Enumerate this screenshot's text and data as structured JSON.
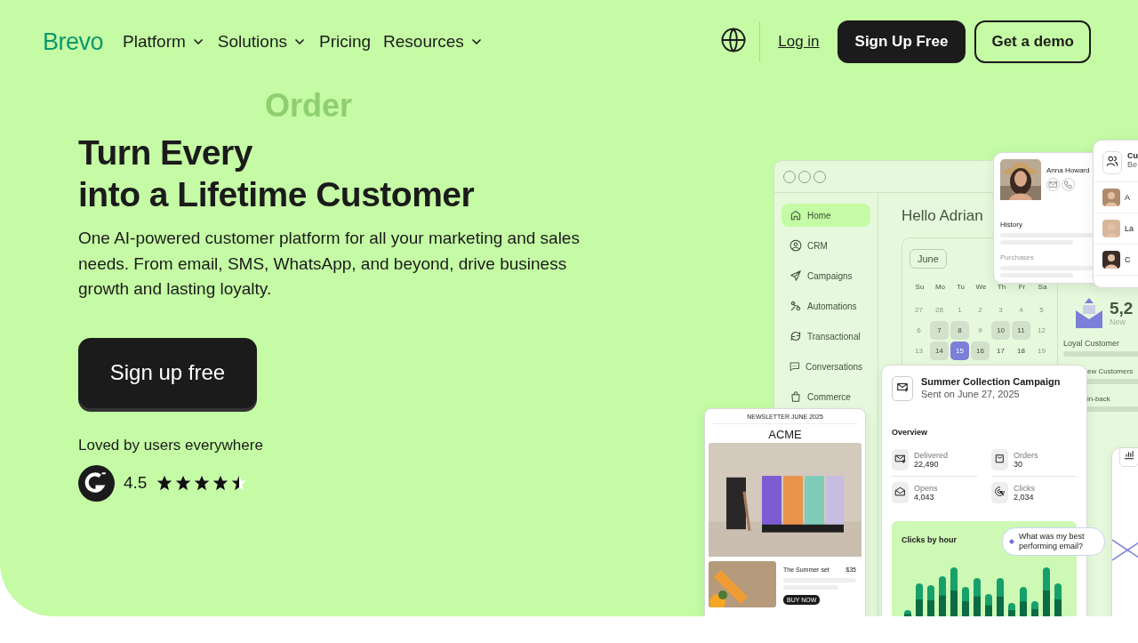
{
  "header": {
    "logo": "Brevo",
    "nav": [
      {
        "label": "Platform",
        "dropdown": true
      },
      {
        "label": "Solutions",
        "dropdown": true
      },
      {
        "label": "Pricing",
        "dropdown": false
      },
      {
        "label": "Resources",
        "dropdown": true
      }
    ],
    "login": "Log in",
    "signup": "Sign Up Free",
    "demo": "Get a demo"
  },
  "hero": {
    "ghost_word": "Order",
    "title_lines": [
      "Turn Every",
      "into a Lifetime Customer"
    ],
    "description": "One AI-powered customer platform for all your marketing and sales needs. From email, SMS, WhatsApp, and beyond, drive business growth and lasting loyalty.",
    "cta": "Sign up free",
    "social_proof": "Loved by users everywhere",
    "rating": {
      "value": "4.5",
      "stars": 4.5
    }
  },
  "app_window": {
    "sidebar": [
      {
        "label": "Home",
        "selected": true
      },
      {
        "label": "CRM",
        "selected": false
      },
      {
        "label": "Campaigns",
        "selected": false
      },
      {
        "label": "Automations",
        "selected": false
      },
      {
        "label": "Transactional",
        "selected": false
      },
      {
        "label": "Conversations",
        "selected": false
      },
      {
        "label": "Commerce",
        "selected": false
      }
    ],
    "greeting": "Hello Adrian",
    "calendar": {
      "month": "June",
      "weekdays": [
        "Su",
        "Mo",
        "Tu",
        "We",
        "Th",
        "Fr",
        "Sa"
      ],
      "days": [
        {
          "day": "27",
          "kind": "muted",
          "selected": false
        },
        {
          "day": "28",
          "kind": "muted",
          "selected": false
        },
        {
          "day": "1",
          "kind": "muted",
          "selected": false
        },
        {
          "day": "2",
          "kind": "muted",
          "selected": false
        },
        {
          "day": "3",
          "kind": "muted",
          "selected": false
        },
        {
          "day": "4",
          "kind": "muted",
          "selected": false
        },
        {
          "day": "5",
          "kind": "muted",
          "selected": false
        },
        {
          "day": "6",
          "kind": "muted",
          "selected": false
        },
        {
          "day": "7",
          "kind": "marked",
          "selected": false
        },
        {
          "day": "8",
          "kind": "marked",
          "selected": false
        },
        {
          "day": "9",
          "kind": "muted",
          "selected": false
        },
        {
          "day": "10",
          "kind": "marked",
          "selected": false
        },
        {
          "day": "11",
          "kind": "marked",
          "selected": false
        },
        {
          "day": "12",
          "kind": "muted",
          "selected": false
        },
        {
          "day": "13",
          "kind": "muted",
          "selected": false
        },
        {
          "day": "14",
          "kind": "marked",
          "selected": false
        },
        {
          "day": "15",
          "kind": "marked",
          "selected": true
        },
        {
          "day": "16",
          "kind": "marked",
          "selected": false
        },
        {
          "day": "17",
          "kind": "plain",
          "selected": false
        },
        {
          "day": "18",
          "kind": "plain",
          "selected": false
        },
        {
          "day": "19",
          "kind": "muted",
          "selected": false
        }
      ]
    },
    "stats": {
      "value": "5,2",
      "label": "New",
      "segments": [
        "Loyal Customer",
        "ew Customers",
        "in-back"
      ]
    }
  },
  "contact_card": {
    "name": "Anna Howard",
    "sections": [
      "History",
      "Purchases"
    ]
  },
  "customers_card": {
    "title": "Cu",
    "subtitle": "Be",
    "rows": [
      "A",
      "La",
      "C"
    ]
  },
  "newsletter": {
    "header": "NEWSLETTER JUNE 2025",
    "brand": "ACME",
    "product": {
      "name": "The Summer set",
      "price": "$35",
      "button": "BUY NOW"
    }
  },
  "campaign": {
    "title": "Summer Collection Campaign",
    "sent": "Sent on June 27, 2025",
    "overview": "Overview",
    "metrics": [
      {
        "label": "Delivered",
        "value": "22,490"
      },
      {
        "label": "Orders",
        "value": "30"
      },
      {
        "label": "Opens",
        "value": "4,043"
      },
      {
        "label": "Clicks",
        "value": "2,034"
      }
    ],
    "chart_title": "Clicks by hour",
    "ai_prompt": "What was my best performing email?"
  }
}
